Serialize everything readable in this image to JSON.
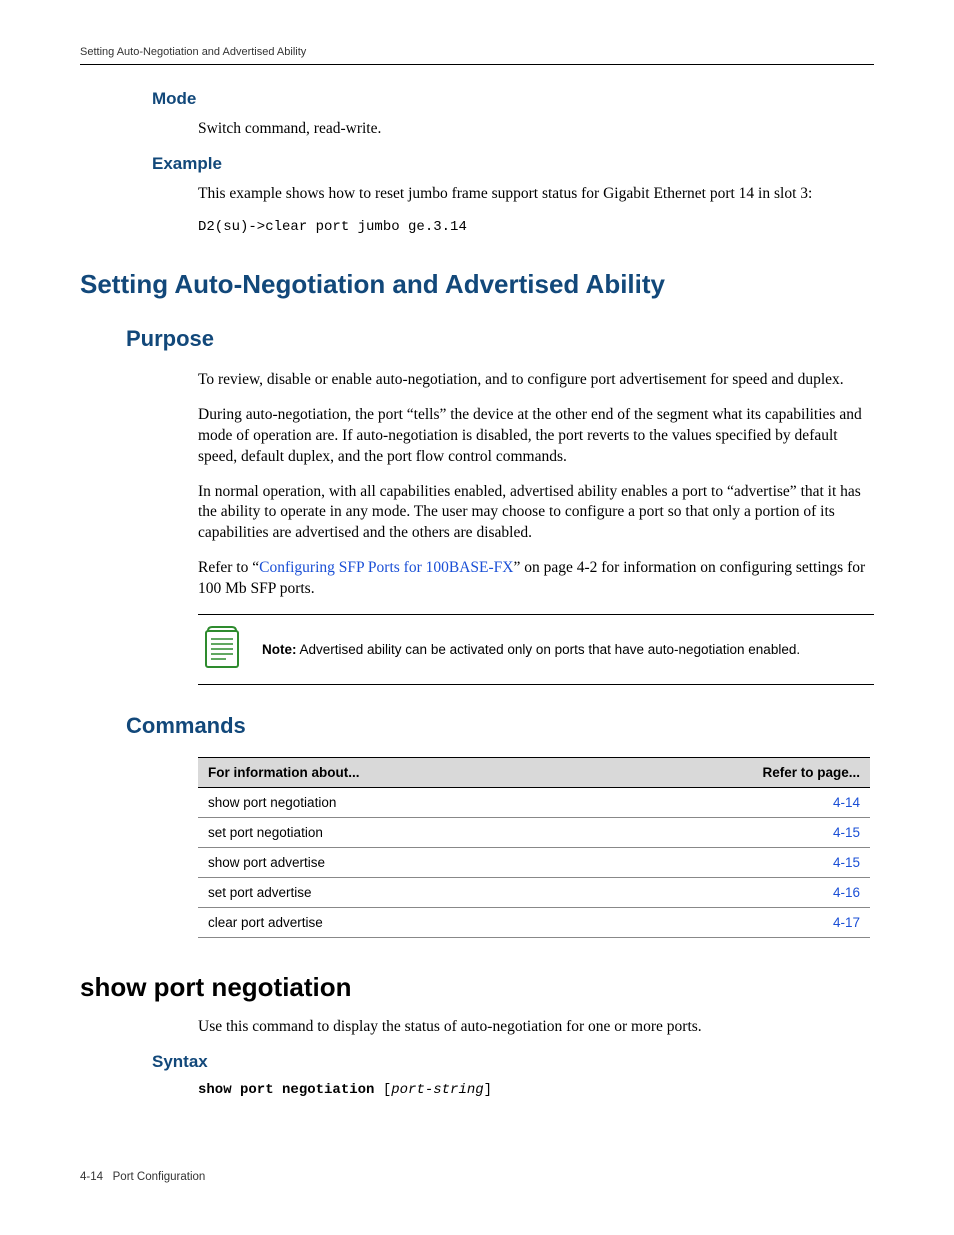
{
  "header": {
    "running": "Setting Auto-Negotiation and Advertised Ability"
  },
  "sec1": {
    "mode_h": "Mode",
    "mode_body": "Switch command, read‐write.",
    "example_h": "Example",
    "example_body": "This example shows how to reset jumbo frame support status for Gigabit Ethernet port 14 in slot 3:",
    "example_code": "D2(su)->clear port jumbo ge.3.14"
  },
  "main": {
    "title": "Setting Auto-Negotiation and Advertised Ability",
    "purpose_h": "Purpose",
    "p1": "To review, disable or enable auto‐negotiation, and to configure port advertisement for speed and duplex.",
    "p2": "During auto‐negotiation, the port “tells” the device at the other end of the segment what its capabilities and mode of operation are. If auto‐negotiation is disabled, the port reverts to the values specified by default speed, default duplex, and the port flow control commands.",
    "p3": "In normal operation, with all capabilities enabled, advertised ability enables a port to “advertise” that it has the ability to operate in any mode. The user may choose to configure a port so that only a portion of its capabilities are advertised and the others are disabled.",
    "p4a": "Refer to “",
    "p4_link": "Configuring SFP Ports for 100BASE‐FX",
    "p4b": "” on page 4‐2 for information on configuring settings for 100 Mb SFP ports.",
    "note_label": "Note:",
    "note_text": " Advertised ability can be activated only on ports that have auto-negotiation enabled.",
    "commands_h": "Commands"
  },
  "table": {
    "col1": "For information about...",
    "col2": "Refer to page...",
    "rows": [
      {
        "name": "show port negotiation",
        "page": "4-14"
      },
      {
        "name": "set port negotiation",
        "page": "4-15"
      },
      {
        "name": "show port advertise",
        "page": "4-15"
      },
      {
        "name": "set port advertise",
        "page": "4-16"
      },
      {
        "name": "clear port advertise",
        "page": "4-17"
      }
    ]
  },
  "cmd": {
    "title": "show port negotiation",
    "desc": "Use this command to display the status of auto‐negotiation for one or more ports.",
    "syntax_h": "Syntax",
    "syntax_cmd": "show port negotiation",
    "syntax_arg": "port-string"
  },
  "footer": {
    "page": "4-14",
    "label": "Port Configuration"
  }
}
